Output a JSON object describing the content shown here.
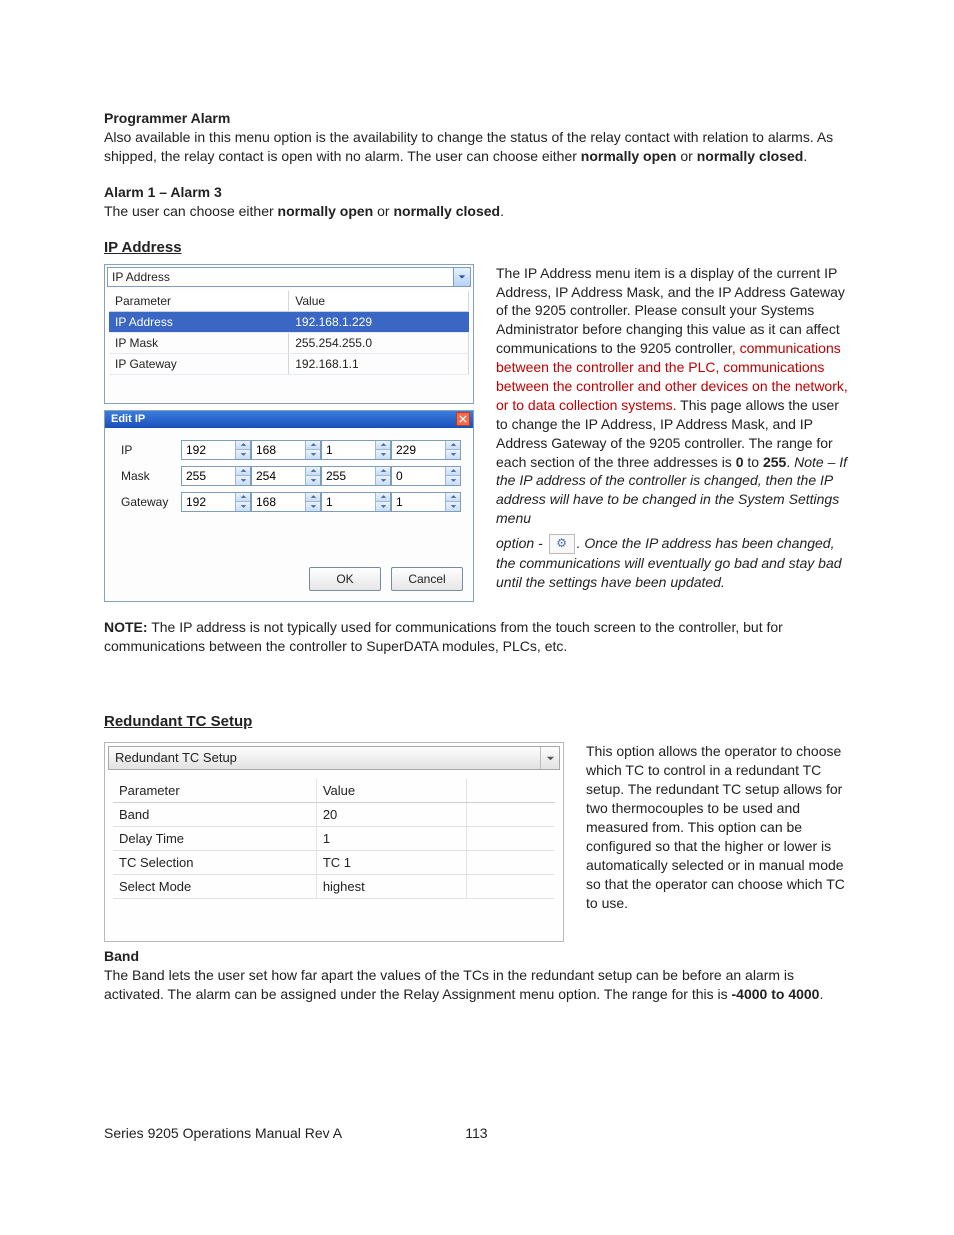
{
  "sec1": {
    "title": "Programmer Alarm",
    "body_a": "Also available in this menu option is the availability to change the status of the relay contact with relation to alarms. As shipped, the relay contact is open with no alarm.  The user can choose either ",
    "bold_no": "normally open",
    "or": " or ",
    "bold_nc": "normally closed",
    "period": "."
  },
  "sec2": {
    "title": "Alarm 1 – Alarm 3",
    "body_a": "The user can choose either ",
    "bold_no": "normally open",
    "or": " or ",
    "bold_nc": "normally closed",
    "period": "."
  },
  "ip_heading": "IP Address",
  "ip_panel": {
    "dropdown_label": "IP Address",
    "col_param": "Parameter",
    "col_value": "Value",
    "rows": [
      {
        "param": "IP Address",
        "value": "192.168.1.229"
      },
      {
        "param": "IP Mask",
        "value": "255.254.255.0"
      },
      {
        "param": "IP Gateway",
        "value": "192.168.1.1"
      }
    ]
  },
  "edit_ip": {
    "title": "Edit IP",
    "labels": {
      "ip": "IP",
      "mask": "Mask",
      "gateway": "Gateway"
    },
    "ip": [
      "192",
      "168",
      "1",
      "229"
    ],
    "mask": [
      "255",
      "254",
      "255",
      "0"
    ],
    "gateway": [
      "192",
      "168",
      "1",
      "1"
    ],
    "ok": "OK",
    "cancel": "Cancel"
  },
  "ip_text": {
    "a": "The IP Address menu item is a display of the current IP Address, IP Address Mask, and the IP Address Gateway of the 9205 controller. Please consult your Systems Administrator before changing this value as it can affect communications to the 9205 controller",
    "red": ", communications between the controller and the PLC, communications between the controller and other devices on the network,  or to data collection systems.",
    "b": "   This page allows the user to change the IP Address, IP Address Mask, and IP Address Gateway of the 9205 controller.  The range for each section of the three addresses is ",
    "zero": "0",
    "to": " to ",
    "max": "255",
    "noteprefix": ".  ",
    "italic1": "Note – If the IP address of the controller is changed, then the IP address will have to be changed in the System Settings menu ",
    "italic_option": "option - ",
    "italic2": ".  Once the IP address has been changed, the communications will eventually go bad and stay bad until the settings have been updated.",
    "notelabel": "NOTE:",
    "notebody": " The IP address is not typically used for communications from the touch screen to the controller, but for communications between the controller to SuperDATA modules, PLCs, etc."
  },
  "tc_heading": "Redundant TC Setup",
  "tc_panel": {
    "dropdown_label": "Redundant TC Setup",
    "col_param": "Parameter",
    "col_value": "Value",
    "rows": [
      {
        "param": "Band",
        "value": "20"
      },
      {
        "param": "Delay Time",
        "value": "1"
      },
      {
        "param": "TC Selection",
        "value": "TC 1"
      },
      {
        "param": "Select Mode",
        "value": "highest"
      }
    ]
  },
  "tc_text": {
    "body": "This option allows the operator to choose which TC to control in a redundant TC setup.  The redundant TC setup allows for two thermocouples to be used and measured from.  This option can be configured so that the higher or lower is automatically selected or in manual mode so that the operator can choose which TC to use."
  },
  "band": {
    "title": "Band",
    "body_a": "The Band lets the user set how far apart the values of the TCs in the redundant setup can be before an alarm is activated.  The alarm can be assigned under the Relay Assignment menu option.  The range for this is ",
    "range": "-4000 to 4000",
    "period": "."
  },
  "footer": {
    "doc": "Series 9205 Operations Manual Rev A",
    "page": "113"
  }
}
